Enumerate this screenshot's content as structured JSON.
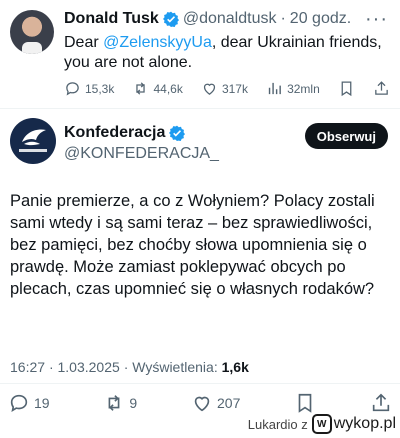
{
  "tweet_quoted": {
    "author_name": "Donald Tusk",
    "handle": "@donaldtusk",
    "separator": "·",
    "time": "20 godz.",
    "text_before": "Dear ",
    "mention": "@ZelenskyyUa",
    "text_after": ", dear Ukrainian friends, you are not alone.",
    "stats": {
      "replies": "15,3k",
      "retweets": "44,6k",
      "likes": "317k",
      "views": "32mln"
    }
  },
  "tweet_main": {
    "author_name": "Konfederacja",
    "handle": "@KONFEDERACJA_",
    "follow_label": "Obserwuj",
    "text": "Panie premierze, a co z Wołyniem? Polacy zostali sami wtedy i są sami teraz – bez sprawiedliwości, bez pamięci, bez choćby słowa upomnienia się o prawdę. Może zamiast poklepywać obcych po plecach, czas upomnieć się o własnych rodaków?",
    "time": "16:27",
    "date": "1.03.2025",
    "views_label": "Wyświetlenia:",
    "views": "1,6k",
    "stats": {
      "replies": "19",
      "retweets": "9",
      "likes": "207"
    }
  },
  "watermark": {
    "author": "Lukardio z",
    "site": "wykop.pl",
    "logo_text": "W"
  },
  "colors": {
    "accent": "#1d9bf0",
    "muted": "#536471",
    "text": "#0f1419"
  },
  "icons": {
    "verified": "verified-badge-icon",
    "reply": "reply-icon",
    "retweet": "retweet-icon",
    "like": "heart-icon",
    "views": "views-bar-icon",
    "bookmark": "bookmark-icon",
    "share": "share-icon",
    "more": "more-icon"
  }
}
